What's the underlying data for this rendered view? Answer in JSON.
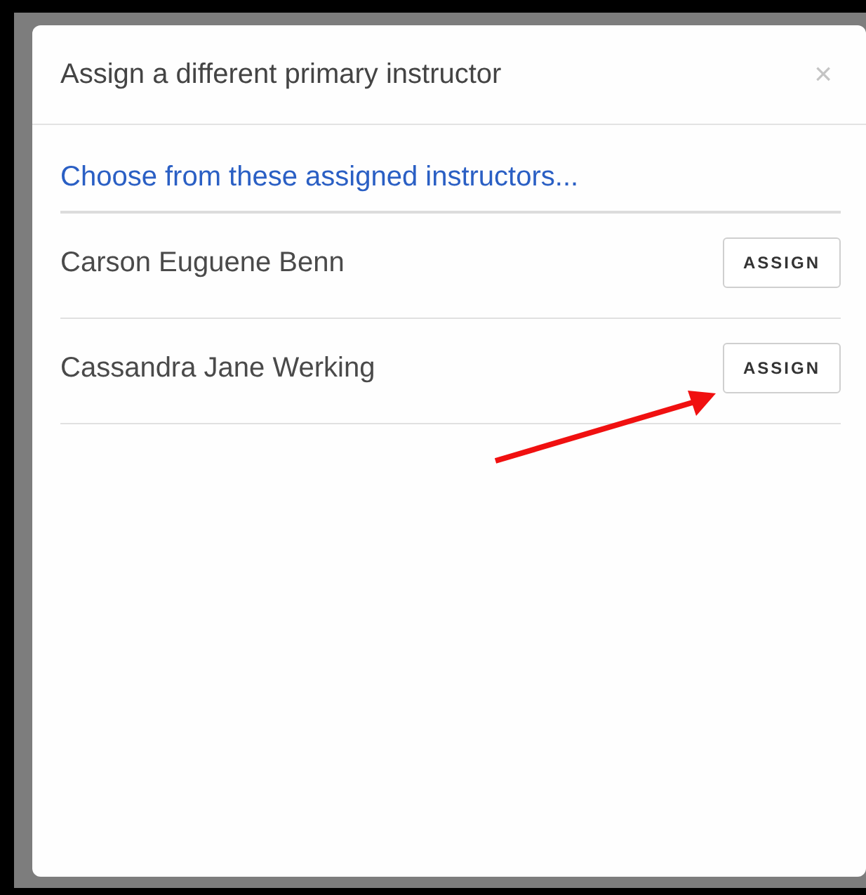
{
  "dialog": {
    "title": "Assign a different primary instructor",
    "close": "×",
    "prompt": "Choose from these assigned instructors...",
    "instructors": [
      {
        "name": "Carson Euguene Benn",
        "action": "ASSIGN"
      },
      {
        "name": "Cassandra Jane Werking",
        "action": "ASSIGN"
      }
    ]
  }
}
